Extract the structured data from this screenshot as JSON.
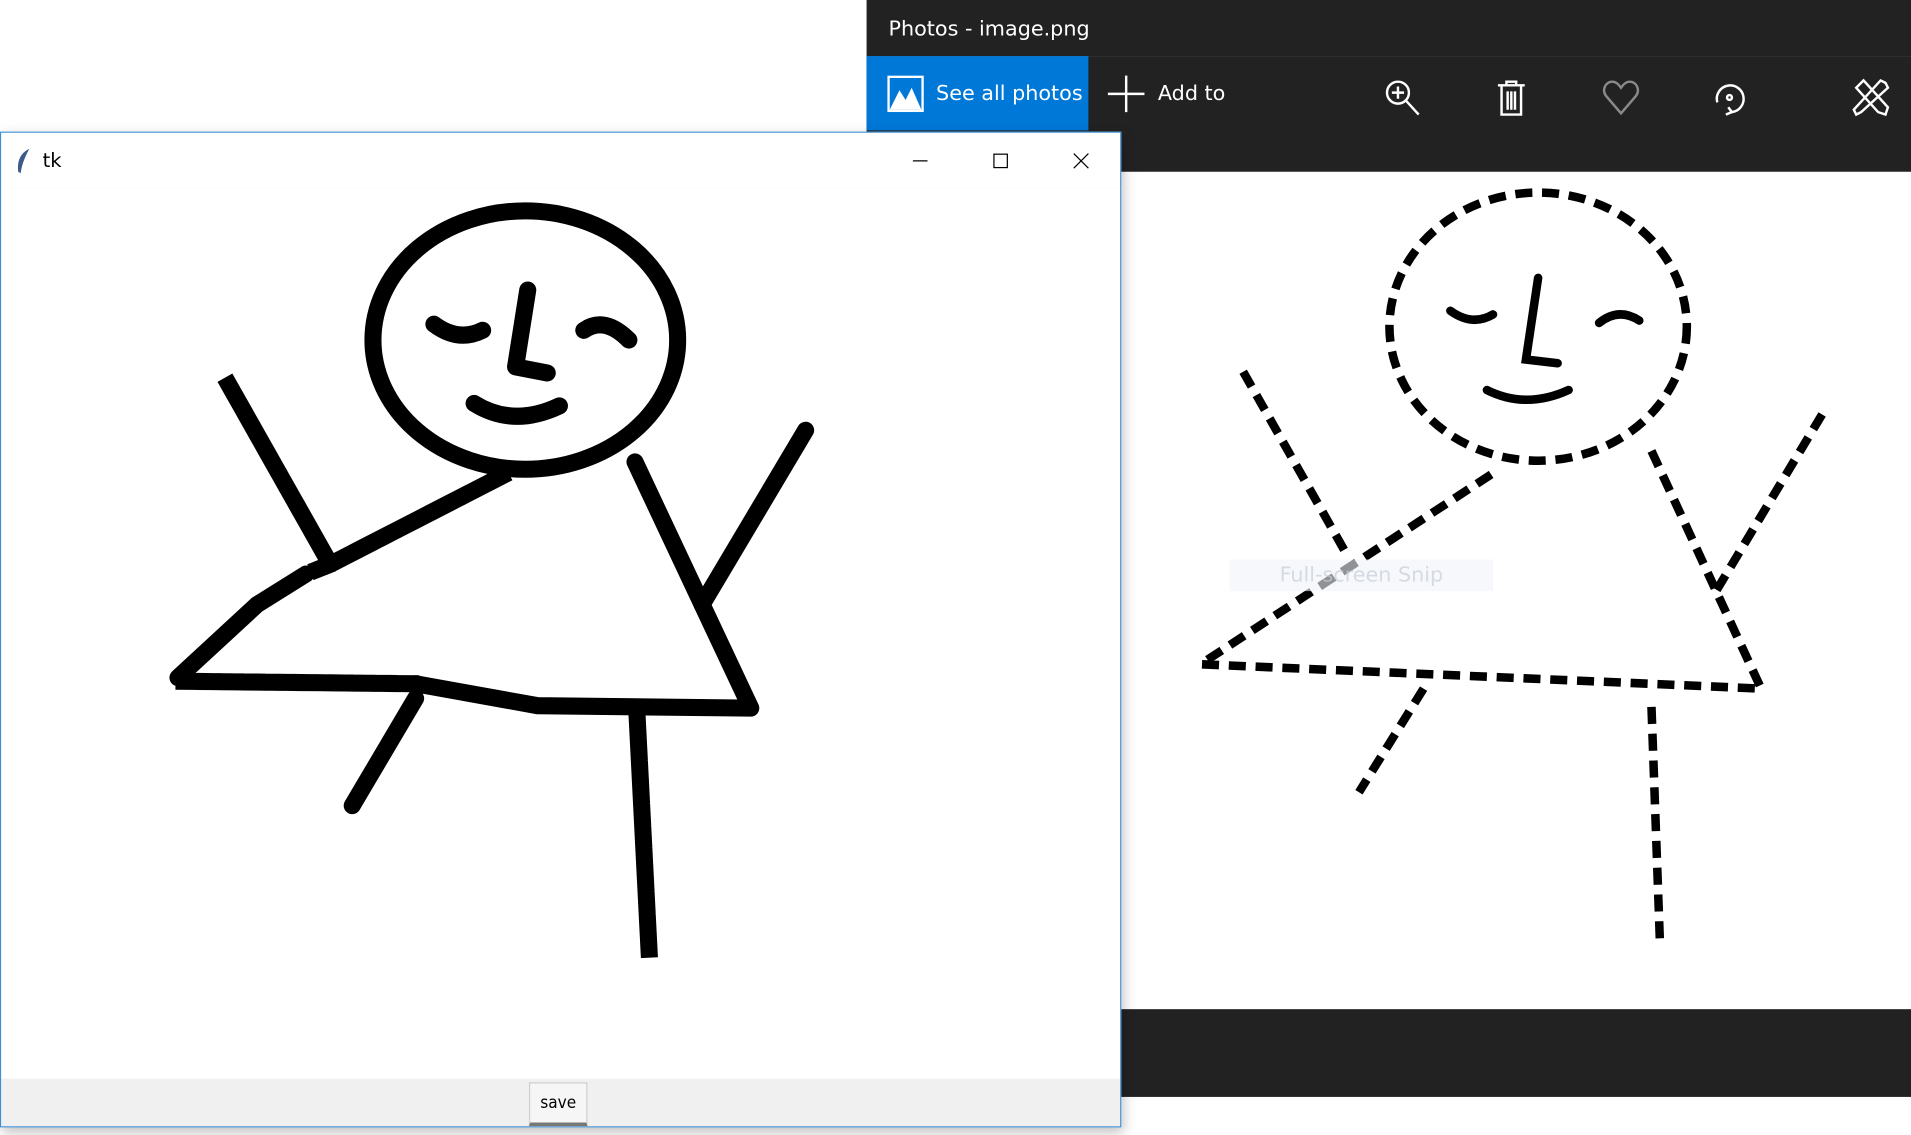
{
  "photos": {
    "title": "Photos - image.png",
    "see_all_label": "See all photos",
    "add_to_label": "Add to",
    "toolbar_icons": [
      "zoom-in-icon",
      "delete-icon",
      "favorite-icon",
      "rotate-icon",
      "edit-icon"
    ],
    "overlay_text": "Full-screen Snip",
    "accent": "#0078d7"
  },
  "tk": {
    "title": "tk",
    "save_label": "save"
  }
}
